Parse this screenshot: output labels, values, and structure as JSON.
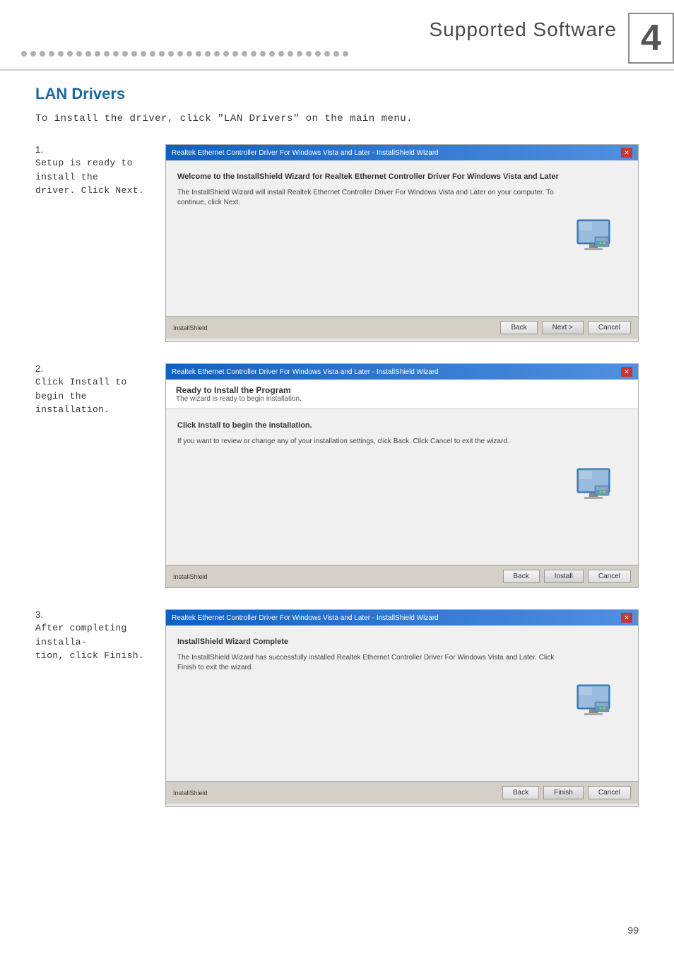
{
  "header": {
    "dots_count": 36,
    "section_title": "Supported Software",
    "chapter_number": "4"
  },
  "lan_section": {
    "title": "LAN Drivers",
    "intro": "To install the driver, click \"LAN Drivers\" on the main menu."
  },
  "steps": [
    {
      "number": "1.",
      "description": "Setup is ready to install the\ndriver. Click Next.",
      "wizard": {
        "titlebar": "Realtek Ethernet Controller Driver For Windows Vista and Later - InstallShield Wizard",
        "has_header": false,
        "bold_text": "Welcome to the InstallShield Wizard for Realtek Ethernet Controller Driver For Windows Vista and Later",
        "normal_text": "The InstallShield Wizard will install Realtek Ethernet Controller Driver For Windows Vista and Later on your computer. To continue, click Next.",
        "footer_left": "InstallShield",
        "buttons": [
          "Back",
          "Next >",
          "Cancel"
        ]
      }
    },
    {
      "number": "2.",
      "description": "Click Install to begin the\ninstallation.",
      "wizard": {
        "titlebar": "Realtek Ethernet Controller Driver For Windows Vista and Later - InstallShield Wizard",
        "has_header": true,
        "header_title": "Ready to Install the Program",
        "header_subtitle": "The wizard is ready to begin installation.",
        "bold_text": "Click Install to begin the installation.",
        "normal_text": "If you want to review or change any of your installation settings, click Back. Click Cancel to exit the wizard.",
        "footer_left": "InstallShield",
        "buttons": [
          "Back",
          "Install",
          "Cancel"
        ]
      }
    },
    {
      "number": "3.",
      "description": "After completing installa-\ntion, click Finish.",
      "wizard": {
        "titlebar": "Realtek Ethernet Controller Driver For Windows Vista and Later - InstallShield Wizard",
        "has_header": false,
        "bold_text": "InstallShield Wizard Complete",
        "normal_text": "The InstallShield Wizard has successfully installed Realtek Ethernet Controller Driver For Windows Vista and Later. Click Finish to exit the wizard.",
        "footer_left": "InstallShield",
        "buttons": [
          "Back",
          "Finish",
          "Cancel"
        ]
      }
    }
  ],
  "page_number": "99"
}
